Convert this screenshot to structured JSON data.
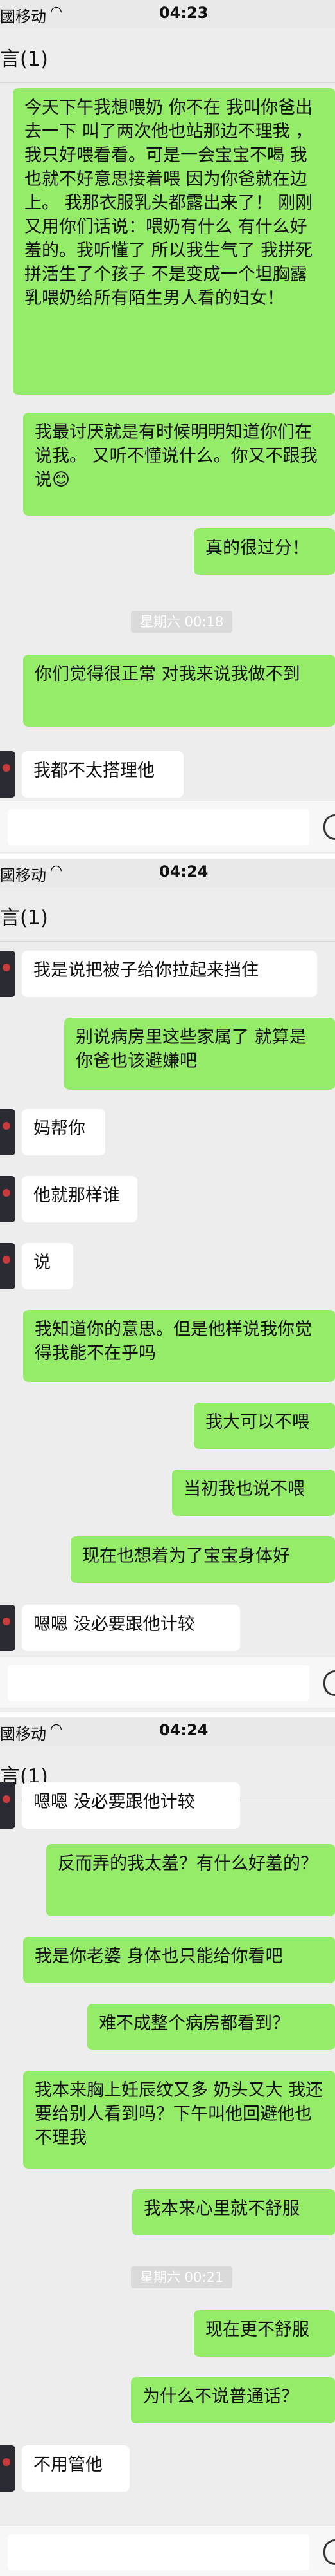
{
  "colors": {
    "outgoing_bubble": "#95ec69",
    "incoming_bubble": "#ffffff",
    "chat_background": "#ededed"
  },
  "screens": [
    {
      "status": {
        "carrier": "國移动",
        "time": "04:23"
      },
      "title": "言(1)",
      "messages": [
        {
          "side": "right",
          "text": "今天下午我想喂奶 你不在 我叫你爸出去一下 叫了两次他也站那边不理我 ，我只好喂看看。可是一会宝宝不喝 我也就不好意思接着喂 因为你爸就在边上。 我那衣服乳头都露出来了！ 刚刚又用你们话说：喂奶有什么 有什么好羞的。我听懂了 所以我生气了 我拼死拼活生了个孩子 不是变成一个坦胸露乳喂奶给所有陌生男人看的妇女！"
        },
        {
          "side": "right",
          "text": "我最讨厌就是有时候明明知道你们在说我。 又听不懂说什么。你又不跟我说😊"
        },
        {
          "side": "right",
          "text": "真的很过分！"
        },
        {
          "side": "time",
          "text": "星期六 00:18"
        },
        {
          "side": "right",
          "text": "你们觉得很正常 对我来说我做不到"
        },
        {
          "side": "left",
          "text": "我都不太搭理他"
        }
      ]
    },
    {
      "status": {
        "carrier": "國移动",
        "time": "04:24"
      },
      "title": "言(1)",
      "messages": [
        {
          "side": "left",
          "text": "我是说把被子给你拉起来挡住"
        },
        {
          "side": "right",
          "text": "别说病房里这些家属了 就算是你爸也该避嫌吧"
        },
        {
          "side": "left",
          "text": "妈帮你"
        },
        {
          "side": "left",
          "text": "他就那样谁"
        },
        {
          "side": "left",
          "text": "说"
        },
        {
          "side": "right",
          "text": "我知道你的意思。但是他样说我你觉得我能不在乎吗"
        },
        {
          "side": "right",
          "text": "我大可以不喂"
        },
        {
          "side": "right",
          "text": "当初我也说不喂"
        },
        {
          "side": "right",
          "text": "现在也想着为了宝宝身体好"
        },
        {
          "side": "left",
          "text": "嗯嗯 没必要跟他计较"
        }
      ]
    },
    {
      "status": {
        "carrier": "國移动",
        "time": "04:24"
      },
      "title": "言(1)",
      "messages": [
        {
          "side": "left",
          "text": "嗯嗯 没必要跟他计较"
        },
        {
          "side": "right",
          "text": "反而弄的我太羞？有什么好羞的？"
        },
        {
          "side": "right",
          "text": "我是你老婆 身体也只能给你看吧"
        },
        {
          "side": "right",
          "text": "难不成整个病房都看到？"
        },
        {
          "side": "right",
          "text": "我本来胸上妊辰纹又多 奶头又大 我还要给别人看到吗？下午叫他回避他也不理我"
        },
        {
          "side": "right",
          "text": "我本来心里就不舒服"
        },
        {
          "side": "time",
          "text": "星期六 00:21"
        },
        {
          "side": "right",
          "text": "现在更不舒服"
        },
        {
          "side": "right",
          "text": "为什么不说普通话？"
        },
        {
          "side": "left",
          "text": "不用管他"
        }
      ]
    }
  ]
}
